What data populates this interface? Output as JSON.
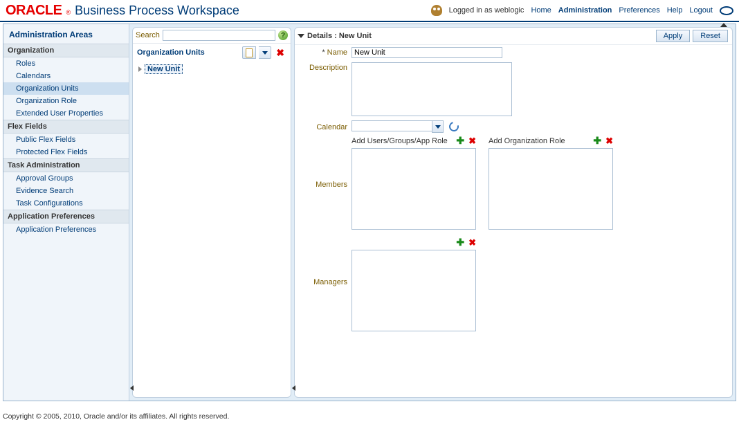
{
  "brand": {
    "oracle": "ORACLE",
    "reg": "®",
    "workspace": "Business Process Workspace"
  },
  "top": {
    "logged_in": "Logged in as weblogic",
    "home": "Home",
    "administration": "Administration",
    "preferences": "Preferences",
    "help": "Help",
    "logout": "Logout"
  },
  "sidebar": {
    "title": "Administration Areas",
    "groups": [
      {
        "header": "Organization",
        "items": [
          "Roles",
          "Calendars",
          "Organization Units",
          "Organization Role",
          "Extended User Properties"
        ],
        "selected": "Organization Units"
      },
      {
        "header": "Flex Fields",
        "items": [
          "Public Flex Fields",
          "Protected Flex Fields"
        ]
      },
      {
        "header": "Task Administration",
        "items": [
          "Approval Groups",
          "Evidence Search",
          "Task Configurations"
        ]
      },
      {
        "header": "Application Preferences",
        "items": [
          "Application Preferences"
        ]
      }
    ]
  },
  "mid": {
    "search_label": "Search",
    "search_value": "",
    "title": "Organization Units",
    "tree_root": "New Unit"
  },
  "detail": {
    "title": "Details : New Unit",
    "apply": "Apply",
    "reset": "Reset",
    "name_label": "Name",
    "name_value": "New Unit",
    "desc_label": "Description",
    "desc_value": "",
    "cal_label": "Calendar",
    "cal_value": "",
    "members_label": "Members",
    "managers_label": "Managers",
    "add_users_label": "Add Users/Groups/App Role",
    "add_orgrole_label": "Add Organization Role"
  },
  "footer": "Copyright © 2005, 2010, Oracle and/or its affiliates. All rights reserved."
}
